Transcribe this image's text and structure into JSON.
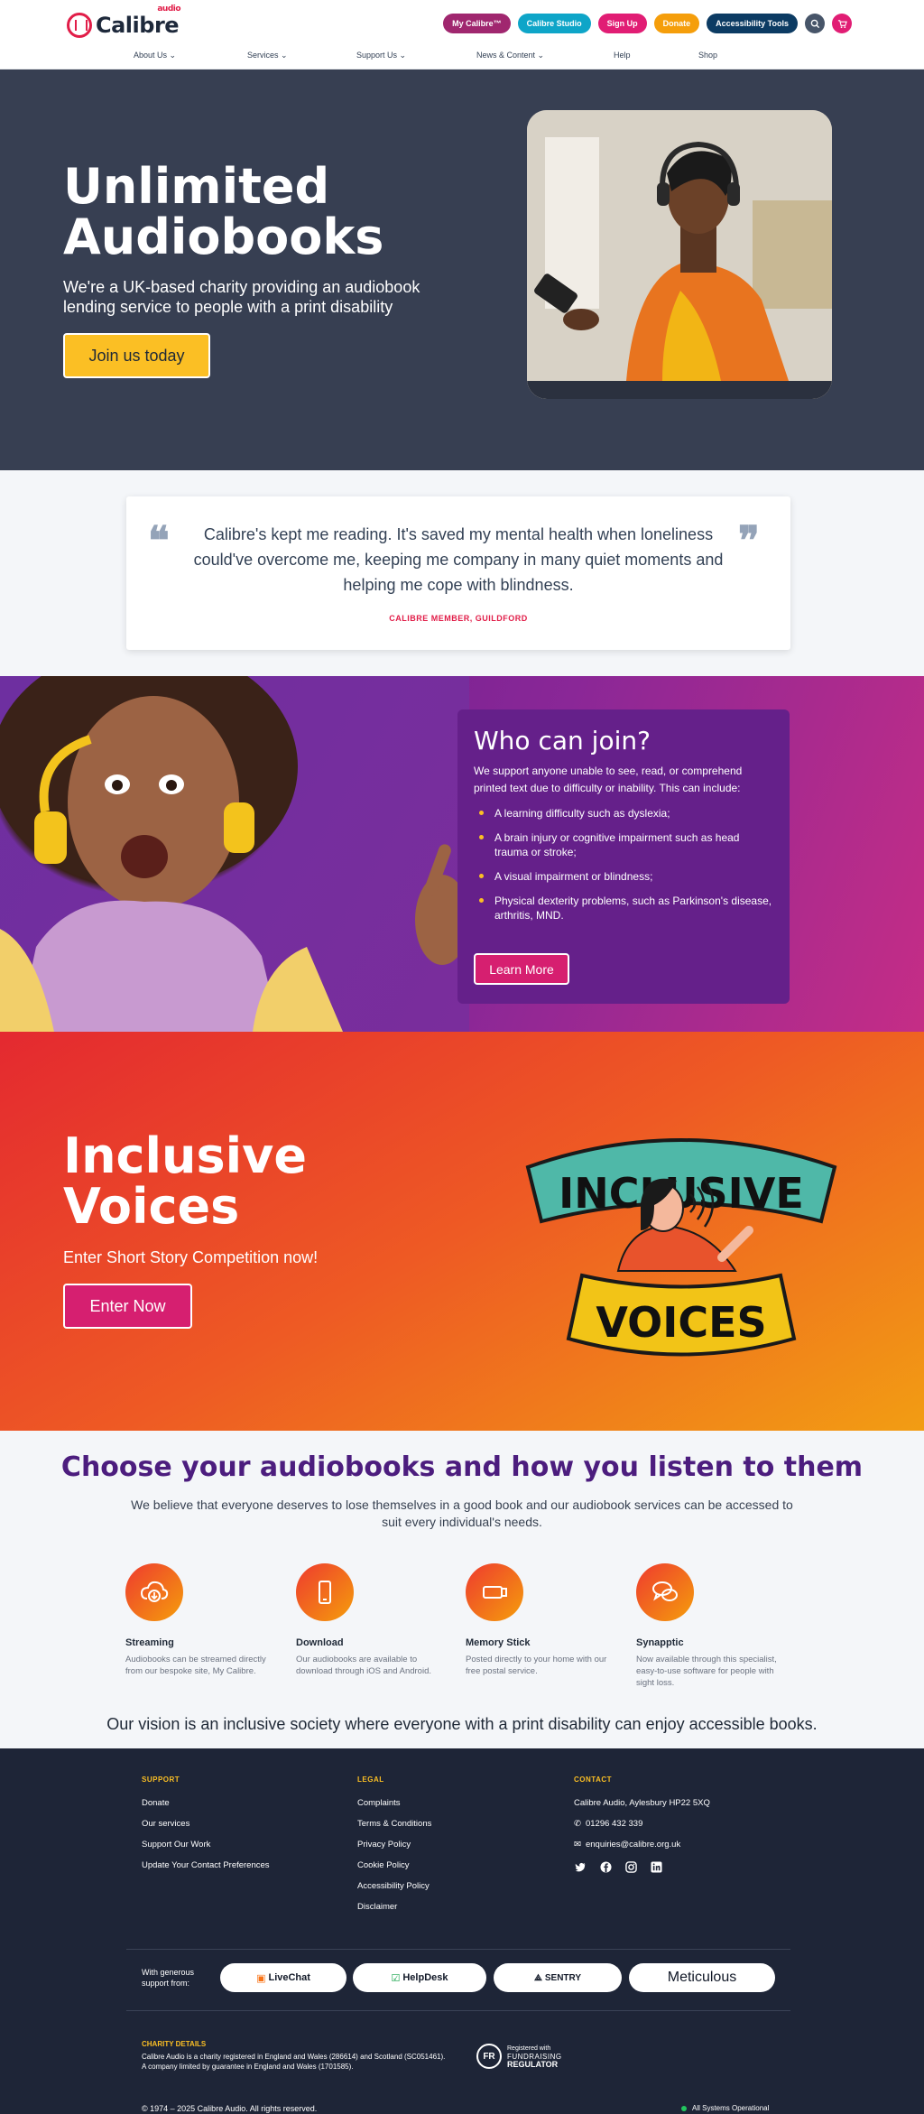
{
  "header": {
    "logo_text": "Calibre",
    "logo_sub": "audio",
    "top_links": [
      "My Calibre™",
      "Calibre Studio",
      "Sign Up",
      "Donate",
      "Accessibility Tools"
    ],
    "nav": [
      "About Us",
      "Services",
      "Support Us",
      "News & Content",
      "Help",
      "Shop"
    ]
  },
  "hero": {
    "title": "Unlimited Audiobooks",
    "subtitle": "We're a UK-based charity providing an audiobook lending service to people with a print disability",
    "button": "Join us today"
  },
  "testimonial": {
    "quote": "Calibre's kept me reading. It's saved my mental health when loneliness could've overcome me, keeping me company in many quiet moments and helping me cope with blindness.",
    "attribution": "CALIBRE MEMBER, GUILDFORD"
  },
  "join": {
    "title": "Who can join?",
    "intro": "We support anyone unable to see, read, or comprehend printed text due to difficulty or inability. This can include:",
    "items": [
      "A learning difficulty such as dyslexia;",
      "A brain injury or cognitive impairment such as head trauma or stroke;",
      "A visual impairment or blindness;",
      "Physical dexterity problems, such as Parkinson's disease, arthritis, MND."
    ],
    "button": "Learn More"
  },
  "inclusive": {
    "title": "Inclusive Voices",
    "subtitle": "Enter Short Story Competition now!",
    "button": "Enter Now",
    "art_top": "INCLUSIVE",
    "art_bottom": "VOICES"
  },
  "choose": {
    "title": "Choose your audiobooks and how you listen to them",
    "subtitle": "We believe that everyone deserves to lose themselves in a good book and our audiobook services can be accessed to suit every individual's needs.",
    "services": [
      {
        "name": "Streaming",
        "desc": "Audiobooks can be streamed directly from our bespoke site, My Calibre.",
        "icon": "cloud-download-icon"
      },
      {
        "name": "Download",
        "desc": "Our audiobooks are available to download through iOS and Android.",
        "icon": "phone-icon"
      },
      {
        "name": "Memory Stick",
        "desc": "Posted directly to your home with our free postal service.",
        "icon": "usb-icon"
      },
      {
        "name": "Synapptic",
        "desc": "Now available through this specialist, easy-to-use software for people with sight loss.",
        "icon": "chat-bubbles-icon"
      }
    ],
    "vision": "Our vision is an inclusive society where everyone with a print disability can enjoy accessible books."
  },
  "footer": {
    "support_head": "SUPPORT",
    "support_links": [
      "Donate",
      "Our services",
      "Support Our Work",
      "Update Your Contact Preferences"
    ],
    "legal_head": "LEGAL",
    "legal_links": [
      "Complaints",
      "Terms & Conditions",
      "Privacy Policy",
      "Cookie Policy",
      "Accessibility Policy",
      "Disclaimer"
    ],
    "contact_head": "CONTACT",
    "address": "Calibre Audio, Aylesbury HP22 5XQ",
    "phone": "01296 432 339",
    "email": "enquiries@calibre.org.uk",
    "support_label": "With generous support from:",
    "sponsors": [
      "LiveChat",
      "HelpDesk",
      "SENTRY",
      "Meticulous"
    ],
    "charity_head": "CHARITY DETAILS",
    "charity_text_1": "Calibre Audio is a charity registered in England and Wales (286614) and Scotland (SC051461).",
    "charity_text_2": "A company limited by guarantee in England and Wales (1701585).",
    "reg_mark": "FR",
    "reg_small": "Registered with",
    "reg_line1": "FUNDRAISING",
    "reg_line2": "REGULATOR",
    "copyright": "© 1974 – 2025 Calibre Audio. All rights reserved.",
    "status": "All Systems Operational"
  }
}
